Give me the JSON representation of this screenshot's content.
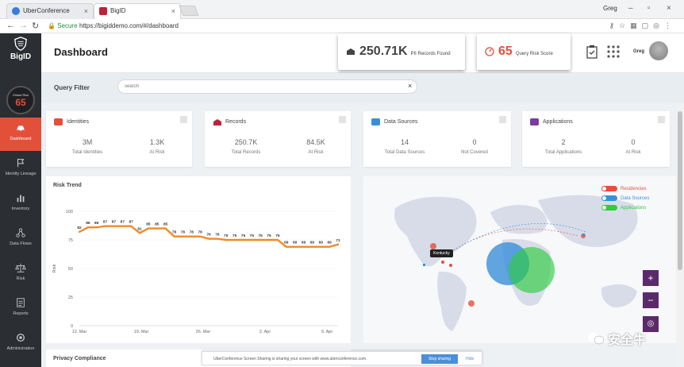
{
  "browser": {
    "tabs": [
      {
        "label": "UberConference",
        "icon": "uberconference-icon",
        "active": false
      },
      {
        "label": "BigID",
        "icon": "bigid-icon",
        "active": true
      }
    ],
    "window_user": "Greg",
    "secure_label": "Secure",
    "url": "https://bigiddemo.com/#/dashboard"
  },
  "sidebar": {
    "logo_text": "BigID",
    "global_risk": {
      "label": "Global Risk",
      "value": "65"
    },
    "items": [
      {
        "label": "Dashboard",
        "icon": "car-icon",
        "active": true
      },
      {
        "label": "Identity Lineage",
        "icon": "flag-icon",
        "active": false
      },
      {
        "label": "Inventory",
        "icon": "bar-chart-icon",
        "active": false
      },
      {
        "label": "Data Flows",
        "icon": "flow-icon",
        "active": false
      },
      {
        "label": "Risk",
        "icon": "scale-icon",
        "active": false
      },
      {
        "label": "Reports",
        "icon": "report-icon",
        "active": false
      },
      {
        "label": "Administration",
        "icon": "gear-icon",
        "active": false
      }
    ]
  },
  "header": {
    "title": "Dashboard",
    "pii": {
      "value": "250.71K",
      "caption": "PII Records Found"
    },
    "risk": {
      "value": "65",
      "caption": "Query Risk Score"
    },
    "user": "Greg"
  },
  "query_filter": {
    "label": "Query Filter",
    "placeholder": "search"
  },
  "cards": [
    {
      "title": "Identities",
      "icon": "identity-card-icon",
      "color": "#e2503a",
      "v1": "3M",
      "l1": "Total Identities",
      "v2": "1.3K",
      "l2": "At Risk"
    },
    {
      "title": "Records",
      "icon": "records-icon",
      "color": "#c0213a",
      "v1": "250.7K",
      "l1": "Total Records",
      "v2": "84.5K",
      "l2": "At Risk"
    },
    {
      "title": "Data Sources",
      "icon": "data-sources-icon",
      "color": "#3a8fd9",
      "v1": "14",
      "l1": "Total Data Sources",
      "v2": "0",
      "l2": "Not Covered"
    },
    {
      "title": "Applications",
      "icon": "applications-icon",
      "color": "#7a3c9a",
      "v1": "2",
      "l1": "Total Applications",
      "v2": "0",
      "l2": "At Risk"
    }
  ],
  "chart_data": {
    "type": "line",
    "title": "Risk Trend",
    "ylabel": "Risk",
    "ylim": [
      0,
      100
    ],
    "yticks": [
      0,
      25,
      50,
      75,
      100
    ],
    "xticks": [
      "12. Mar",
      "19. Mar",
      "26. Mar",
      "2. Apr",
      "9. Apr"
    ],
    "series": [
      {
        "values": [
          82,
          86,
          86,
          87,
          87,
          87,
          87,
          81,
          85,
          85,
          85,
          78,
          78,
          78,
          78,
          76,
          76,
          75,
          75,
          75,
          75,
          75,
          75,
          75,
          69,
          69,
          69,
          69,
          69,
          69,
          71
        ],
        "color": "#f08a2a"
      }
    ]
  },
  "map": {
    "legend": [
      {
        "label": "Residencies",
        "color": "#e2503a"
      },
      {
        "label": "Data Sources",
        "color": "#3a8fd9"
      },
      {
        "label": "Applications",
        "color": "#2ecc40"
      }
    ],
    "tooltip": "Kentucky"
  },
  "privacy": {
    "title": "Privacy Compliance"
  },
  "share_bar": {
    "text": "UberConference Screen Sharing is sharing your screen with www.uberconference.com.",
    "stop_label": "Stop sharing",
    "hide_label": "Hide"
  },
  "watermark": "安全牛"
}
